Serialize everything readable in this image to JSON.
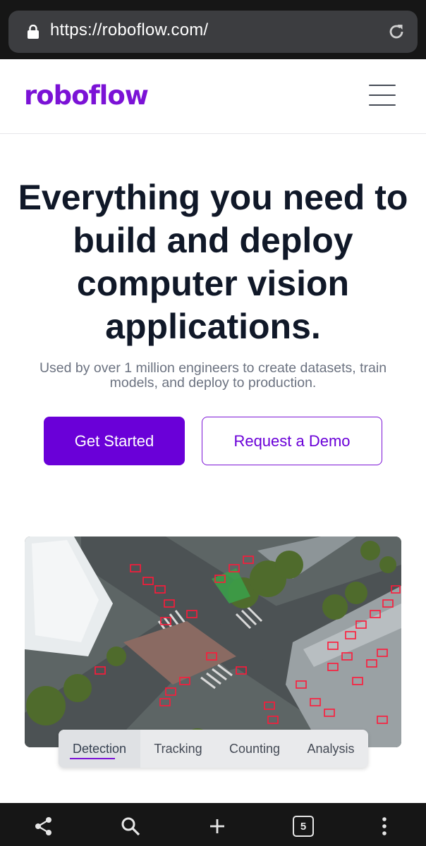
{
  "browser": {
    "url": "https://roboflow.com/",
    "tab_count": "5",
    "icons": [
      "lock-icon",
      "reload-icon",
      "share-icon",
      "search-icon",
      "plus-icon",
      "tabs-icon",
      "more-icon"
    ]
  },
  "header": {
    "logo": "roboflow",
    "menu_icon": "hamburger-menu-icon"
  },
  "hero": {
    "title": "Everything you need to build and deploy computer vision applications.",
    "subtitle": "Used by over 1 million engineers to create datasets, train models, and deploy to production.",
    "primary_cta": "Get Started",
    "secondary_cta": "Request a Demo"
  },
  "demo": {
    "tabs": [
      {
        "label": "Detection",
        "active": true
      },
      {
        "label": "Tracking",
        "active": false
      },
      {
        "label": "Counting",
        "active": false
      },
      {
        "label": "Analysis",
        "active": false
      }
    ]
  },
  "colors": {
    "brand": "#6a00d8",
    "logo": "#7b12d6",
    "title": "#101828",
    "subtitle": "#6b7280",
    "chrome": "#161616",
    "detection_box": "#ff1a3a"
  }
}
